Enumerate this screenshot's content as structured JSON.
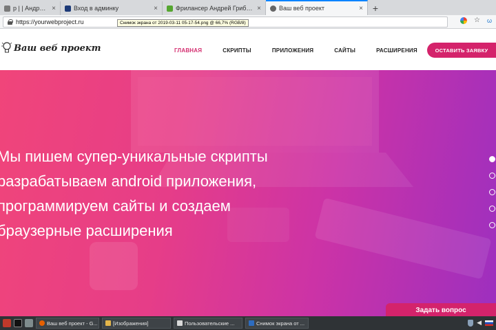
{
  "browser": {
    "tabs": [
      {
        "title": "р | | Андрей Грибин",
        "active": false,
        "icon_color": "#7a7a7a"
      },
      {
        "title": "Вход в админку",
        "active": false,
        "icon_color": "#1d3a78"
      },
      {
        "title": "Фрилансер Андрей Грибин А",
        "active": false,
        "icon_color": "#55a630"
      },
      {
        "title": "Ваш веб проект",
        "active": true,
        "icon_color": "#666666"
      }
    ],
    "new_tab_label": "+",
    "close_glyph": "×",
    "url": "https://yourwebproject.ru",
    "tooltip": "Снимок экрана от 2019-03-11 05-17-54.png @ 66,7% (RGB/8)"
  },
  "site": {
    "logo_text": "Ваш веб проект",
    "nav": [
      {
        "label": "ГЛАВНАЯ",
        "active": true
      },
      {
        "label": "СКРИПТЫ",
        "active": false
      },
      {
        "label": "ПРИЛОЖЕНИЯ",
        "active": false
      },
      {
        "label": "САЙТЫ",
        "active": false
      },
      {
        "label": "РАСШИРЕНИЯ",
        "active": false
      }
    ],
    "cta_label": "ОСТАВИТЬ ЗАЯВКУ",
    "hero_lines": [
      "Мы пишем супер-уникальные скрипты",
      "разрабатываем android приложения,",
      "программируем сайты и создаем",
      "браузерные расширения"
    ],
    "slider_dot_count": 5,
    "ask_label": "Задать вопрос",
    "accent_color": "#d4236b"
  },
  "taskbar": {
    "items": [
      {
        "label": "Ваш веб проект - G...",
        "icon_color": "#e66000"
      },
      {
        "label": "[Изображения]",
        "icon_color": "#e3b54a"
      },
      {
        "label": "Пользовательские ...",
        "icon_color": "#d9d9d9"
      },
      {
        "label": "Снимок экрана от ...",
        "icon_color": "#2d6cc0"
      }
    ]
  }
}
